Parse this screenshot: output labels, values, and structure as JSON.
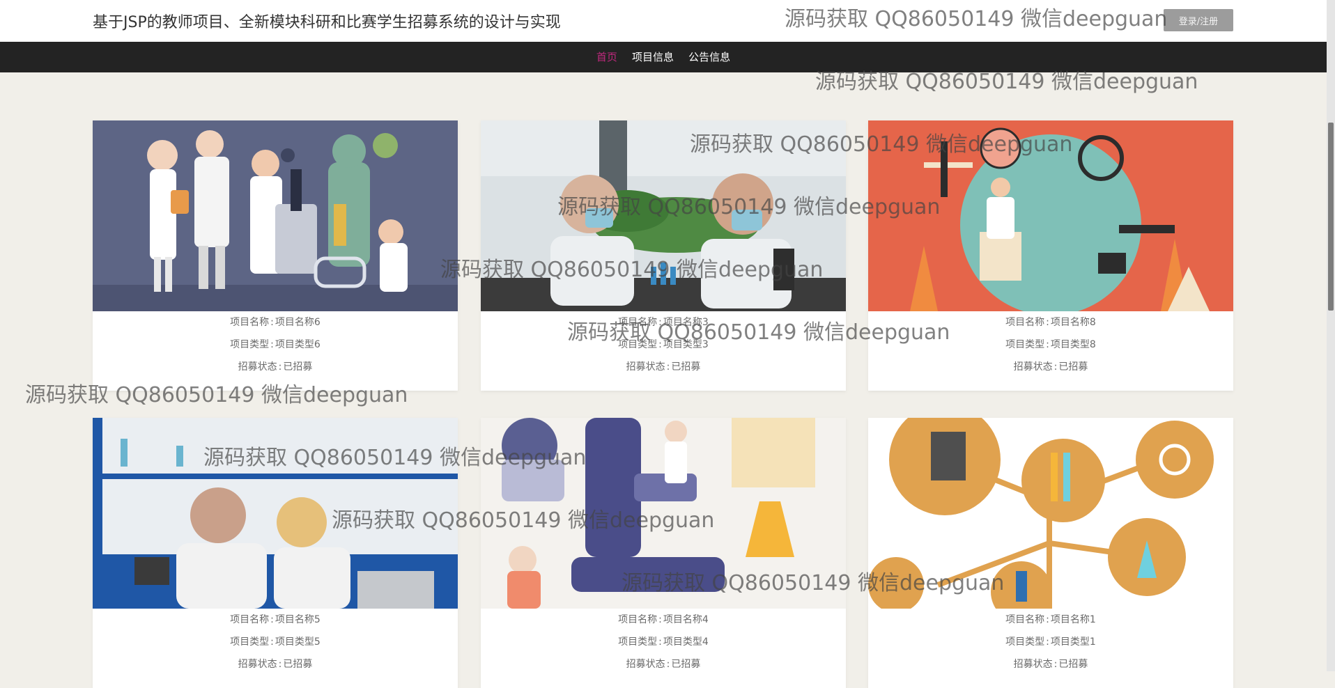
{
  "header": {
    "title": "基于JSP的教师项目、全新模块科研和比赛学生招募系统的设计与实现",
    "login_label": "登录/注册"
  },
  "nav": {
    "items": [
      {
        "label": "首页",
        "active": true
      },
      {
        "label": "项目信息",
        "active": false
      },
      {
        "label": "公告信息",
        "active": false
      }
    ],
    "active_color": "#c0297e"
  },
  "cards": [
    {
      "name_label": "项目名称",
      "name": "项目名称6",
      "type_label": "项目类型",
      "type": "项目类型6",
      "status_label": "招募状态",
      "status": "已招募",
      "picture": "scientists-illustration"
    },
    {
      "name_label": "项目名称",
      "name": "项目名称3",
      "type_label": "项目类型",
      "type": "项目类型3",
      "status_label": "招募状态",
      "status": "已招募",
      "picture": "lab-researchers-photo"
    },
    {
      "name_label": "项目名称",
      "name": "项目名称8",
      "type_label": "项目类型",
      "type": "项目类型8",
      "status_label": "招募状态",
      "status": "已招募",
      "picture": "science-lab-illustration"
    },
    {
      "name_label": "项目名称",
      "name": "项目名称5",
      "type_label": "项目类型",
      "type": "项目类型5",
      "status_label": "招募状态",
      "status": "已招募",
      "picture": "lab-discussion-photo"
    },
    {
      "name_label": "项目名称",
      "name": "项目名称4",
      "type_label": "项目类型",
      "type": "项目类型4",
      "status_label": "招募状态",
      "status": "已招募",
      "picture": "microscope-illustration"
    },
    {
      "name_label": "项目名称",
      "name": "项目名称1",
      "type_label": "项目类型",
      "type": "项目类型1",
      "status_label": "招募状态",
      "status": "已招募",
      "picture": "science-icons-illustration"
    }
  ],
  "watermark": {
    "text": "源码获取 QQ86050149 微信deepguan"
  },
  "colors": {
    "page_background": "#f1efe9",
    "nav_background": "#232323",
    "button_background": "#9c9c9c"
  }
}
